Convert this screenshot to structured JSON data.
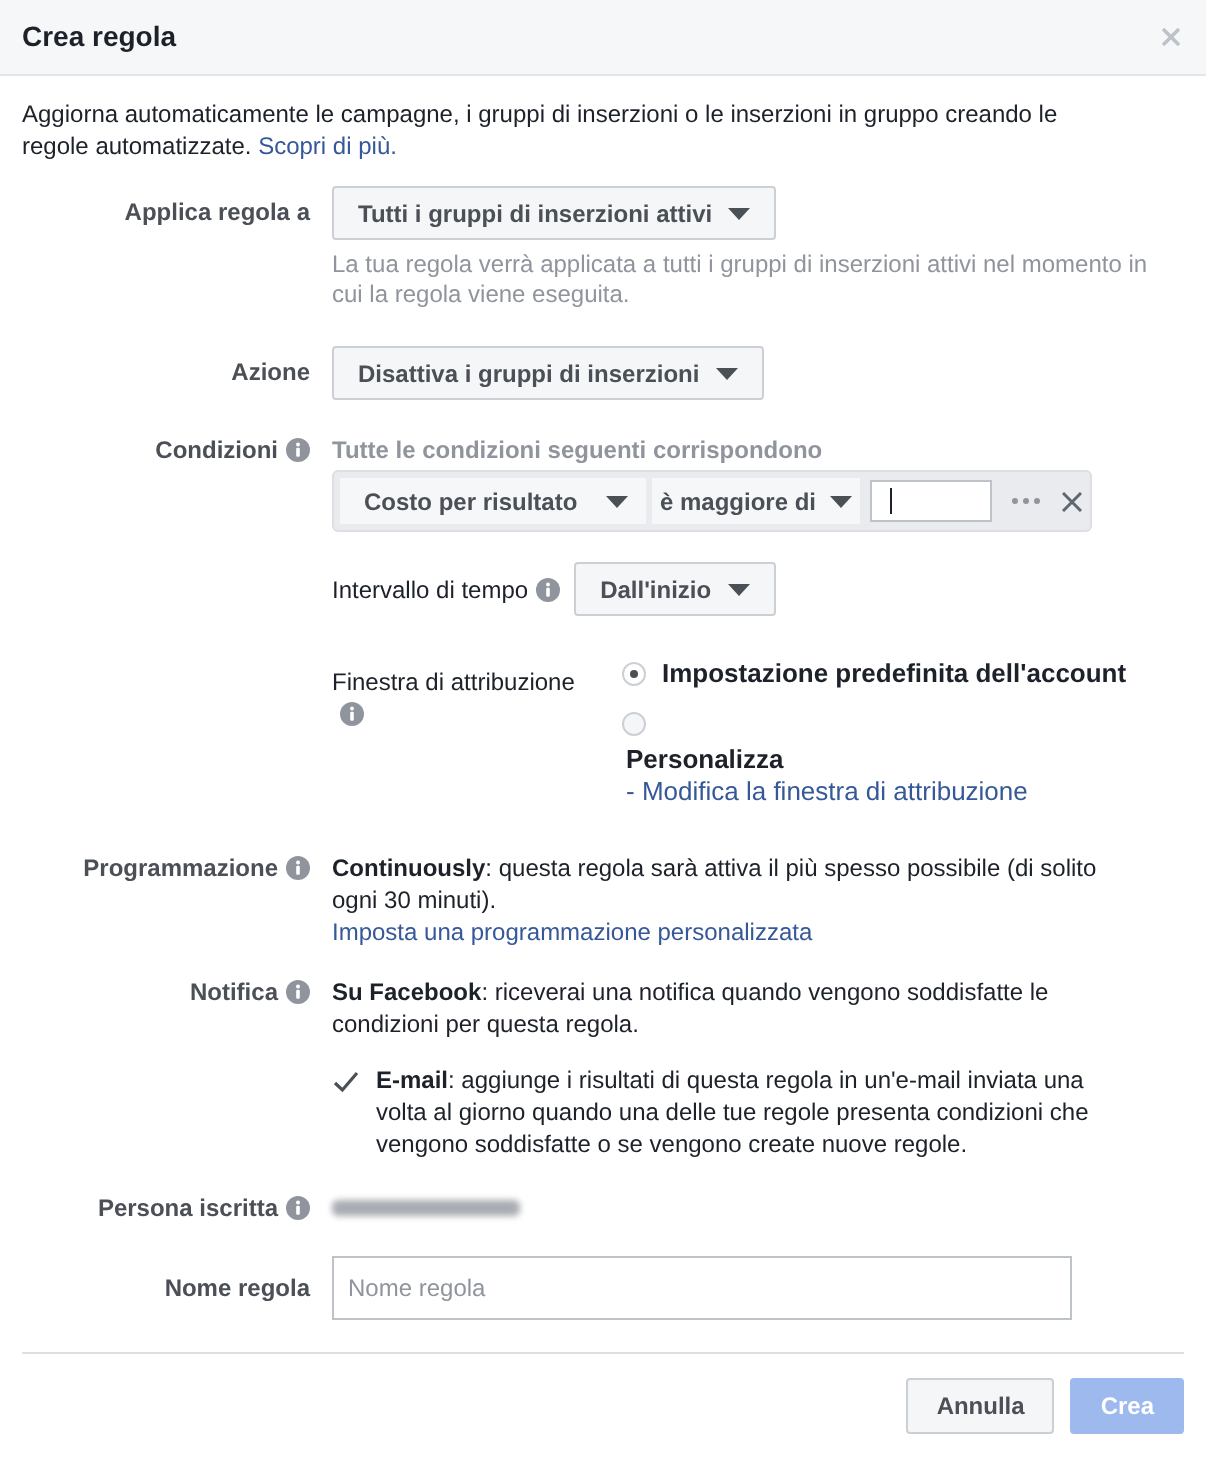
{
  "dialog": {
    "title": "Crea regola"
  },
  "intro": {
    "text": "Aggiorna automaticamente le campagne, i gruppi di inserzioni o le inserzioni in gruppo creando le regole automatizzate.",
    "link": "Scopri di più."
  },
  "apply_to": {
    "label": "Applica regola a",
    "value": "Tutti i gruppi di inserzioni attivi",
    "help": "La tua regola verrà applicata a tutti i gruppi di inserzioni attivi nel momento in cui la regola viene eseguita."
  },
  "action": {
    "label": "Azione",
    "value": "Disattiva i gruppi di inserzioni"
  },
  "conditions": {
    "label": "Condizioni",
    "summary": "Tutte le condizioni seguenti corrispondono",
    "rows": [
      {
        "metric": "Costo per risultato",
        "operator": "è maggiore di"
      }
    ]
  },
  "time_range": {
    "label": "Intervallo di tempo",
    "value": "Dall'inizio"
  },
  "attribution": {
    "label": "Finestra di attribuzione",
    "options": [
      {
        "label": "Impostazione predefinita dell'account",
        "selected": true
      },
      {
        "label": "Personalizza",
        "link": "- Modifica la finestra di attribuzione",
        "selected": false
      }
    ]
  },
  "schedule": {
    "label": "Programmazione",
    "text": "**Continuously**: questa regola sarà attiva il più spesso possibile (di solito ogni 30 minuti).",
    "link": "Imposta una programmazione personalizzata"
  },
  "notification": {
    "label": "Notifica",
    "text": "**Su Facebook**: riceverai una notifica quando vengono soddisfatte le condizioni per questa regola.",
    "email": {
      "text": "**E-mail**: aggiunge i risultati di questa regola in un'e-mail inviata una volta al giorno quando una delle tue regole presenta condizioni che vengono soddisfatte o se vengono create nuove regole.",
      "checked": true
    }
  },
  "subscriber": {
    "label": "Persona iscritta"
  },
  "rule_name": {
    "label": "Nome regola",
    "placeholder": "Nome regola"
  },
  "buttons": [
    {
      "label": "Annulla",
      "kind": "secondary",
      "disabled": false
    },
    {
      "label": "Crea",
      "kind": "primary",
      "disabled": true
    }
  ]
}
